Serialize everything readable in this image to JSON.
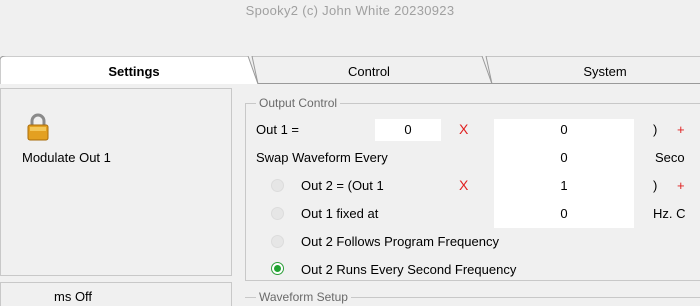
{
  "window": {
    "title": "Spooky2 (c) John White 20230923"
  },
  "tabs": [
    {
      "label": "Settings",
      "active": true
    },
    {
      "label": "Control",
      "active": false
    },
    {
      "label": "System",
      "active": false
    }
  ],
  "left_panel": {
    "modulate_label": "Modulate Out 1",
    "bottom_label": "ms Off"
  },
  "output_control": {
    "title": "Output Control",
    "out1_label": "Out 1 =",
    "out1_value": "0",
    "out1_mult_value": "0",
    "out1_tail": ")",
    "swap_label": "Swap Waveform Every",
    "swap_value": "0",
    "swap_tail": "Seco",
    "out2_label": "Out 2 = (Out 1",
    "out2_value": "1",
    "out2_tail": ")",
    "fixed_label": "Out 1 fixed at",
    "fixed_value": "0",
    "fixed_tail": "Hz. C",
    "follows_label": "Out 2 Follows Program Frequency",
    "second_label": "Out 2 Runs Every Second Frequency",
    "x_symbol": "X",
    "plus_symbol": "+",
    "selected_option": "Out 2 Runs Every Second Frequency",
    "accent_color": "#e02020",
    "radio_color": "#21a332"
  },
  "waveform_setup": {
    "title": "Waveform Setup"
  }
}
